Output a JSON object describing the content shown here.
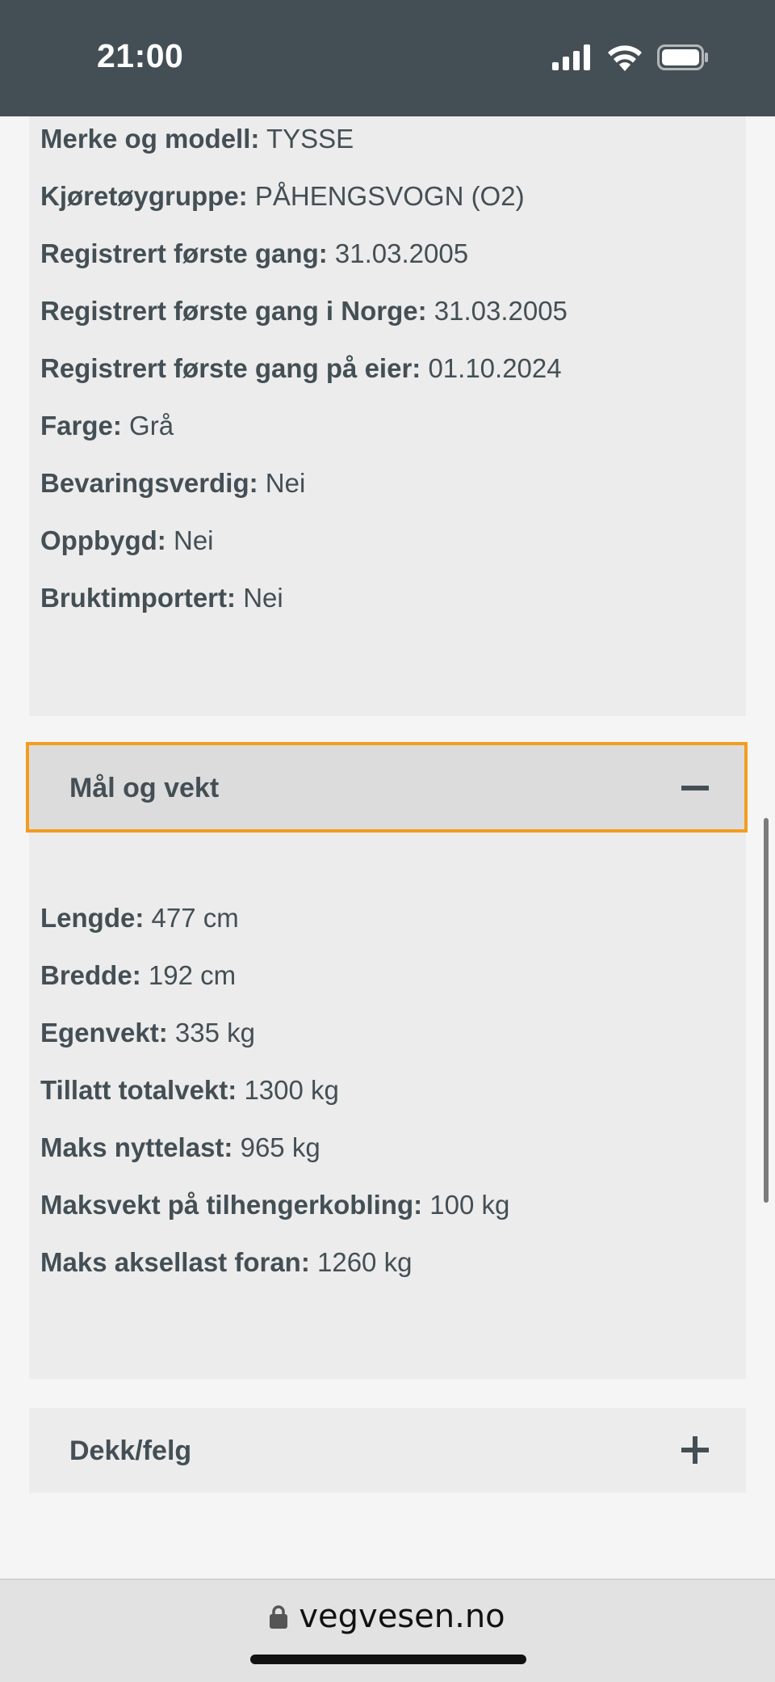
{
  "status_bar": {
    "time": "21:00"
  },
  "vehicle_info": {
    "fields": [
      {
        "label": "Merke og modell:",
        "value": "TYSSE"
      },
      {
        "label": "Kjøretøygruppe:",
        "value": "PÅHENGSVOGN (O2)"
      },
      {
        "label": "Registrert første gang:",
        "value": "31.03.2005"
      },
      {
        "label": "Registrert første gang i Norge:",
        "value": "31.03.2005"
      },
      {
        "label": "Registrert første gang på eier:",
        "value": "01.10.2024"
      },
      {
        "label": "Farge:",
        "value": "Grå"
      },
      {
        "label": "Bevaringsverdig:",
        "value": "Nei"
      },
      {
        "label": "Oppbygd:",
        "value": "Nei"
      },
      {
        "label": "Bruktimportert:",
        "value": "Nei"
      }
    ]
  },
  "mal_og_vekt": {
    "title": "Mål og vekt",
    "toggle": "−",
    "expanded": true,
    "fields": [
      {
        "label": "Lengde:",
        "value": "477 cm"
      },
      {
        "label": "Bredde:",
        "value": "192 cm"
      },
      {
        "label": "Egenvekt:",
        "value": "335 kg"
      },
      {
        "label": "Tillatt totalvekt:",
        "value": "1300 kg"
      },
      {
        "label": "Maks nyttelast:",
        "value": "965 kg"
      },
      {
        "label": "Maksvekt på tilhengerkobling:",
        "value": "100 kg"
      },
      {
        "label": "Maks aksellast foran:",
        "value": "1260 kg"
      }
    ]
  },
  "dekk_felg": {
    "title": "Dekk/felg",
    "toggle": "+",
    "expanded": false
  },
  "browser": {
    "url": "vegvesen.no"
  },
  "colors": {
    "status_bar": "#444f55",
    "focus_outline": "#f29d1f",
    "text": "#444f55",
    "card_bg": "#ececec"
  }
}
